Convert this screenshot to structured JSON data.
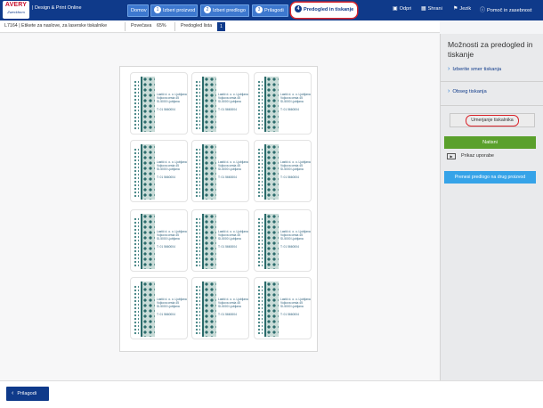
{
  "header": {
    "logo_top": "AVERY",
    "logo_bottom": "Zweckform",
    "app_title": "| Design & Print Online",
    "steps": [
      {
        "num": "",
        "label": "Domov"
      },
      {
        "num": "1",
        "label": "Izberi proizvod"
      },
      {
        "num": "2",
        "label": "Izberi predlogo"
      },
      {
        "num": "3",
        "label": "Prilagodi"
      },
      {
        "num": "4",
        "label": "Predogled in tiskanje"
      }
    ],
    "nav": {
      "open": "Odpri",
      "save": "Shrani",
      "language": "Jezik",
      "help": "Pomoč in zasebnost"
    }
  },
  "subbar": {
    "product": "L7164 | Etikete za naslove, za laserske tiskalnike",
    "zoom_label": "Povečava",
    "zoom_value": "65%",
    "preview_label": "Predogled lista",
    "page": "1"
  },
  "label": {
    "line1": "Lastič d. o. o. Ljubljana",
    "line2": "Vojkova cesta 45",
    "line3": "SI-5000 Ljubljana",
    "tel": "T: 01 5660004"
  },
  "panel": {
    "title": "Možnosti za predogled in tiskanje",
    "link_direction": "Izberite smer tiskanja",
    "link_range": "Obseg tiskanja",
    "calibrate": "Umerjanje tiskalnika",
    "print": "Natisni",
    "video": "Prikaz uporabe",
    "transfer": "Prenesi predlogo na drug proizvod"
  },
  "footer": {
    "back": "Prilagodi"
  },
  "colors": {
    "nav": "#0f3a8a",
    "step": "#3d78cf",
    "highlight": "#d9262d",
    "print": "#5aa02c",
    "transfer": "#35a3e8",
    "label_pattern": "#2b6b6b"
  }
}
